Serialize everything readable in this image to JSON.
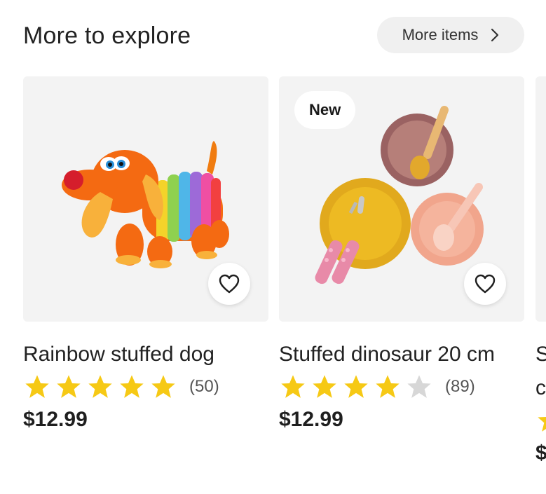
{
  "header": {
    "title": "More to explore",
    "more_label": "More items"
  },
  "products": [
    {
      "badge": "",
      "title": "Rainbow stuffed dog",
      "rating": 5,
      "reviews": "(50)",
      "price": "$12.99"
    },
    {
      "badge": "New",
      "title": "Stuffed dinosaur 20 cm",
      "rating": 4,
      "reviews": "(89)",
      "price": "$12.99"
    }
  ],
  "partial_card": {
    "title_line1": "S",
    "title_line2": "c",
    "price": "$"
  },
  "colors": {
    "star_filled": "#f6c915",
    "star_empty": "#d7d7d7",
    "card_bg": "#f3f3f3"
  }
}
